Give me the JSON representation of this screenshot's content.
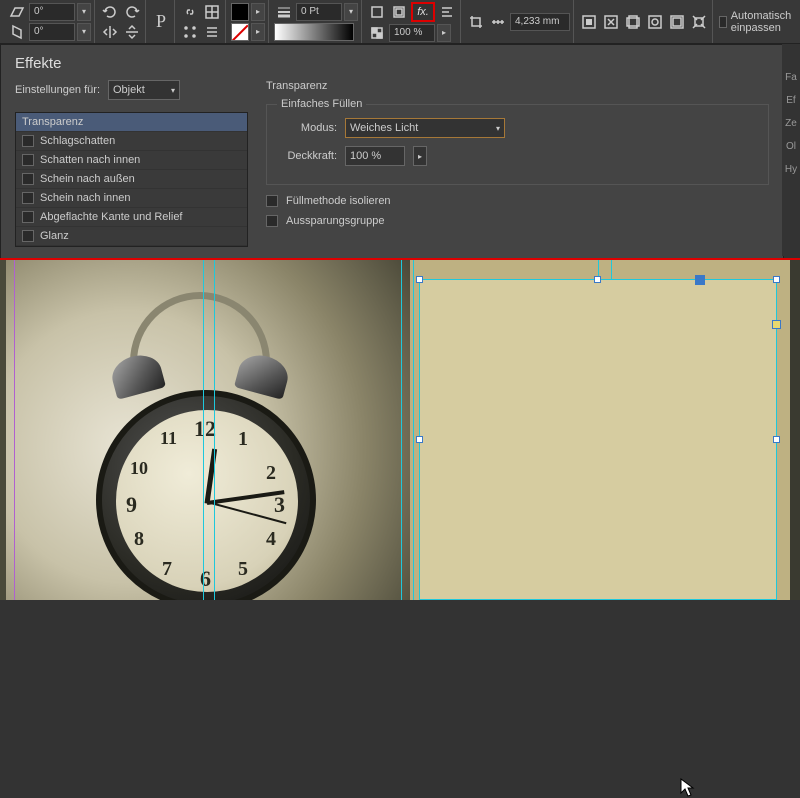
{
  "toolbar": {
    "angle1": "0°",
    "angle2": "0°",
    "stroke_weight": "0 Pt",
    "fx_label": "fx.",
    "opacity": "100 %",
    "measurement": "4,233 mm",
    "autofit_label": "Automatisch einpassen"
  },
  "dialog": {
    "title": "Effekte",
    "settings_for_label": "Einstellungen für:",
    "settings_for_value": "Objekt",
    "transparency_label": "Transparenz",
    "fill_section": "Einfaches Füllen",
    "mode_label": "Modus:",
    "mode_value": "Weiches Licht",
    "opacity_label": "Deckkraft:",
    "opacity_value": "100 %",
    "isolate_label": "Füllmethode isolieren",
    "knockout_label": "Aussparungsgruppe",
    "effects": [
      "Transparenz",
      "Schlagschatten",
      "Schatten nach innen",
      "Schein nach außen",
      "Schein nach innen",
      "Abgeflachte Kante und Relief",
      "Glanz"
    ]
  },
  "right_tabs": [
    "Fa",
    "Ef",
    "Ze",
    "Ol",
    "Hy"
  ],
  "clock_numbers": [
    "12",
    "1",
    "2",
    "3",
    "4",
    "5",
    "6",
    "7",
    "8",
    "9",
    "10",
    "11"
  ]
}
